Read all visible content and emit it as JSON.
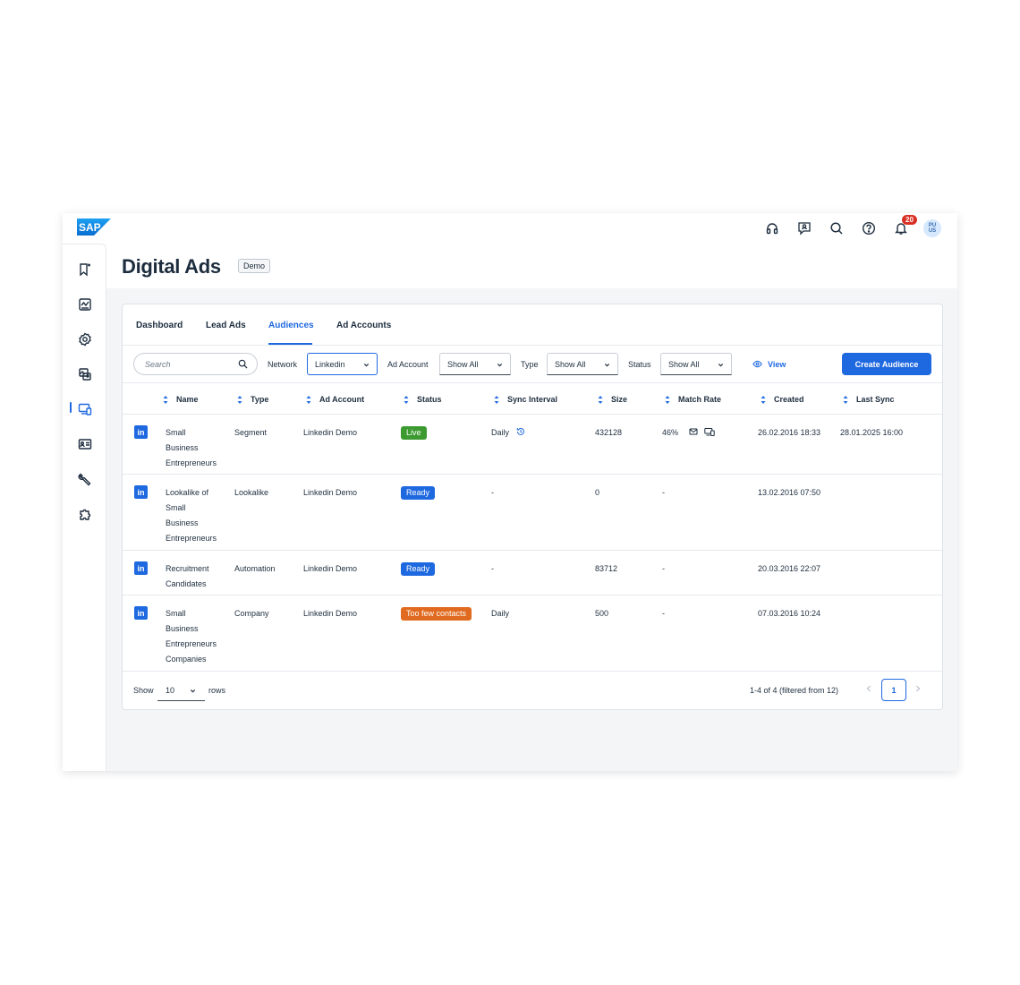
{
  "brand": {
    "logo_text": "SAP",
    "accent": "#1f69e0"
  },
  "topbar": {
    "icons": [
      "headset-icon",
      "feedback-icon",
      "search-icon",
      "help-icon",
      "bell-icon"
    ],
    "notification_count": "20",
    "avatar_line1": "PU",
    "avatar_line2": "US"
  },
  "sidebar": {
    "items": [
      {
        "icon": "bookmark-icon"
      },
      {
        "icon": "analytics-icon"
      },
      {
        "icon": "settings-icon"
      },
      {
        "icon": "images-icon"
      },
      {
        "icon": "devices-icon",
        "active": true
      },
      {
        "icon": "contact-card-icon"
      },
      {
        "icon": "tools-icon"
      },
      {
        "icon": "puzzle-icon"
      }
    ]
  },
  "header": {
    "title": "Digital Ads",
    "badge": "Demo"
  },
  "tabs": [
    {
      "label": "Dashboard"
    },
    {
      "label": "Lead Ads"
    },
    {
      "label": "Audiences",
      "active": true
    },
    {
      "label": "Ad Accounts"
    }
  ],
  "filters": {
    "search_placeholder": "Search",
    "network_label": "Network",
    "network_value": "Linkedin",
    "ad_account_label": "Ad Account",
    "ad_account_value": "Show All",
    "type_label": "Type",
    "type_value": "Show All",
    "status_label": "Status",
    "status_value": "Show All",
    "view_label": "View",
    "create_label": "Create Audience"
  },
  "table": {
    "columns": [
      "Name",
      "Type",
      "Ad Account",
      "Status",
      "Sync Interval",
      "Size",
      "Match Rate",
      "Created",
      "Last Sync"
    ],
    "rows": [
      {
        "name_lines": [
          "Small",
          "Business",
          "Entrepreneurs"
        ],
        "type": "Segment",
        "ad_account": "Linkedin Demo",
        "status": "Live",
        "status_color": "#3c9a31",
        "sync": "Daily",
        "size": "432128",
        "match": "46%",
        "created": "26.02.2016 18:33",
        "last_sync": "28.01.2025 16:00"
      },
      {
        "name_lines": [
          "Lookalike of",
          "Small",
          "Business",
          "Entrepreneurs"
        ],
        "type": "Lookalike",
        "ad_account": "Linkedin Demo",
        "status": "Ready",
        "status_color": "#1f69e0",
        "sync": "-",
        "size": "0",
        "match": "-",
        "created": "13.02.2016 07:50",
        "last_sync": ""
      },
      {
        "name_lines": [
          "Recruitment",
          "Candidates"
        ],
        "type": "Automation",
        "ad_account": "Linkedin Demo",
        "status": "Ready",
        "status_color": "#1f69e0",
        "sync": "-",
        "size": "83712",
        "match": "-",
        "created": "20.03.2016 22:07",
        "last_sync": ""
      },
      {
        "name_lines": [
          "Small",
          "Business",
          "Entrepreneurs",
          "Companies"
        ],
        "type": "Company",
        "ad_account": "Linkedin Demo",
        "status": "Too few contacts",
        "status_color": "#e06a1f",
        "sync": "Daily",
        "size": "500",
        "match": "-",
        "created": "07.03.2016 10:24",
        "last_sync": ""
      }
    ]
  },
  "footer": {
    "show_label": "Show",
    "rows_value": "10",
    "rows_label": "rows",
    "range_text": "1-4 of 4 (filtered from 12)",
    "current_page": "1"
  },
  "network_logo_text": "in"
}
